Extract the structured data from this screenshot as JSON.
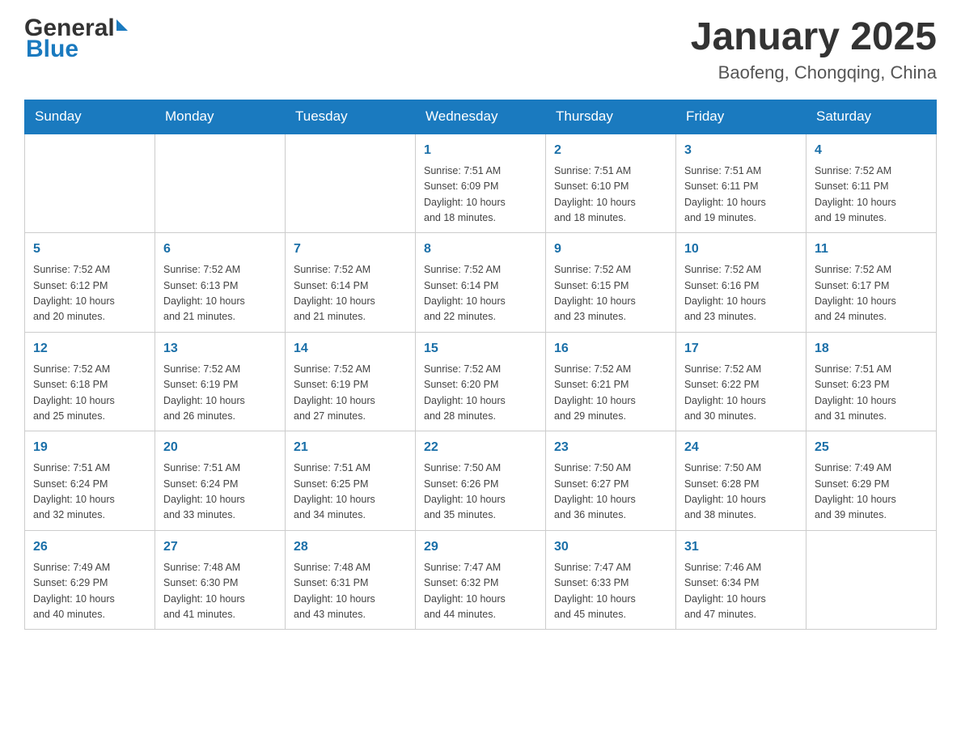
{
  "header": {
    "logo_general": "General",
    "logo_blue": "Blue",
    "month_year": "January 2025",
    "location": "Baofeng, Chongqing, China"
  },
  "days_of_week": [
    "Sunday",
    "Monday",
    "Tuesday",
    "Wednesday",
    "Thursday",
    "Friday",
    "Saturday"
  ],
  "weeks": [
    [
      {
        "day": "",
        "info": ""
      },
      {
        "day": "",
        "info": ""
      },
      {
        "day": "",
        "info": ""
      },
      {
        "day": "1",
        "info": "Sunrise: 7:51 AM\nSunset: 6:09 PM\nDaylight: 10 hours\nand 18 minutes."
      },
      {
        "day": "2",
        "info": "Sunrise: 7:51 AM\nSunset: 6:10 PM\nDaylight: 10 hours\nand 18 minutes."
      },
      {
        "day": "3",
        "info": "Sunrise: 7:51 AM\nSunset: 6:11 PM\nDaylight: 10 hours\nand 19 minutes."
      },
      {
        "day": "4",
        "info": "Sunrise: 7:52 AM\nSunset: 6:11 PM\nDaylight: 10 hours\nand 19 minutes."
      }
    ],
    [
      {
        "day": "5",
        "info": "Sunrise: 7:52 AM\nSunset: 6:12 PM\nDaylight: 10 hours\nand 20 minutes."
      },
      {
        "day": "6",
        "info": "Sunrise: 7:52 AM\nSunset: 6:13 PM\nDaylight: 10 hours\nand 21 minutes."
      },
      {
        "day": "7",
        "info": "Sunrise: 7:52 AM\nSunset: 6:14 PM\nDaylight: 10 hours\nand 21 minutes."
      },
      {
        "day": "8",
        "info": "Sunrise: 7:52 AM\nSunset: 6:14 PM\nDaylight: 10 hours\nand 22 minutes."
      },
      {
        "day": "9",
        "info": "Sunrise: 7:52 AM\nSunset: 6:15 PM\nDaylight: 10 hours\nand 23 minutes."
      },
      {
        "day": "10",
        "info": "Sunrise: 7:52 AM\nSunset: 6:16 PM\nDaylight: 10 hours\nand 23 minutes."
      },
      {
        "day": "11",
        "info": "Sunrise: 7:52 AM\nSunset: 6:17 PM\nDaylight: 10 hours\nand 24 minutes."
      }
    ],
    [
      {
        "day": "12",
        "info": "Sunrise: 7:52 AM\nSunset: 6:18 PM\nDaylight: 10 hours\nand 25 minutes."
      },
      {
        "day": "13",
        "info": "Sunrise: 7:52 AM\nSunset: 6:19 PM\nDaylight: 10 hours\nand 26 minutes."
      },
      {
        "day": "14",
        "info": "Sunrise: 7:52 AM\nSunset: 6:19 PM\nDaylight: 10 hours\nand 27 minutes."
      },
      {
        "day": "15",
        "info": "Sunrise: 7:52 AM\nSunset: 6:20 PM\nDaylight: 10 hours\nand 28 minutes."
      },
      {
        "day": "16",
        "info": "Sunrise: 7:52 AM\nSunset: 6:21 PM\nDaylight: 10 hours\nand 29 minutes."
      },
      {
        "day": "17",
        "info": "Sunrise: 7:52 AM\nSunset: 6:22 PM\nDaylight: 10 hours\nand 30 minutes."
      },
      {
        "day": "18",
        "info": "Sunrise: 7:51 AM\nSunset: 6:23 PM\nDaylight: 10 hours\nand 31 minutes."
      }
    ],
    [
      {
        "day": "19",
        "info": "Sunrise: 7:51 AM\nSunset: 6:24 PM\nDaylight: 10 hours\nand 32 minutes."
      },
      {
        "day": "20",
        "info": "Sunrise: 7:51 AM\nSunset: 6:24 PM\nDaylight: 10 hours\nand 33 minutes."
      },
      {
        "day": "21",
        "info": "Sunrise: 7:51 AM\nSunset: 6:25 PM\nDaylight: 10 hours\nand 34 minutes."
      },
      {
        "day": "22",
        "info": "Sunrise: 7:50 AM\nSunset: 6:26 PM\nDaylight: 10 hours\nand 35 minutes."
      },
      {
        "day": "23",
        "info": "Sunrise: 7:50 AM\nSunset: 6:27 PM\nDaylight: 10 hours\nand 36 minutes."
      },
      {
        "day": "24",
        "info": "Sunrise: 7:50 AM\nSunset: 6:28 PM\nDaylight: 10 hours\nand 38 minutes."
      },
      {
        "day": "25",
        "info": "Sunrise: 7:49 AM\nSunset: 6:29 PM\nDaylight: 10 hours\nand 39 minutes."
      }
    ],
    [
      {
        "day": "26",
        "info": "Sunrise: 7:49 AM\nSunset: 6:29 PM\nDaylight: 10 hours\nand 40 minutes."
      },
      {
        "day": "27",
        "info": "Sunrise: 7:48 AM\nSunset: 6:30 PM\nDaylight: 10 hours\nand 41 minutes."
      },
      {
        "day": "28",
        "info": "Sunrise: 7:48 AM\nSunset: 6:31 PM\nDaylight: 10 hours\nand 43 minutes."
      },
      {
        "day": "29",
        "info": "Sunrise: 7:47 AM\nSunset: 6:32 PM\nDaylight: 10 hours\nand 44 minutes."
      },
      {
        "day": "30",
        "info": "Sunrise: 7:47 AM\nSunset: 6:33 PM\nDaylight: 10 hours\nand 45 minutes."
      },
      {
        "day": "31",
        "info": "Sunrise: 7:46 AM\nSunset: 6:34 PM\nDaylight: 10 hours\nand 47 minutes."
      },
      {
        "day": "",
        "info": ""
      }
    ]
  ],
  "colors": {
    "header_bg": "#1a7abf",
    "header_text": "#ffffff",
    "day_num_color": "#1a6fa8",
    "border_color": "#cccccc"
  }
}
